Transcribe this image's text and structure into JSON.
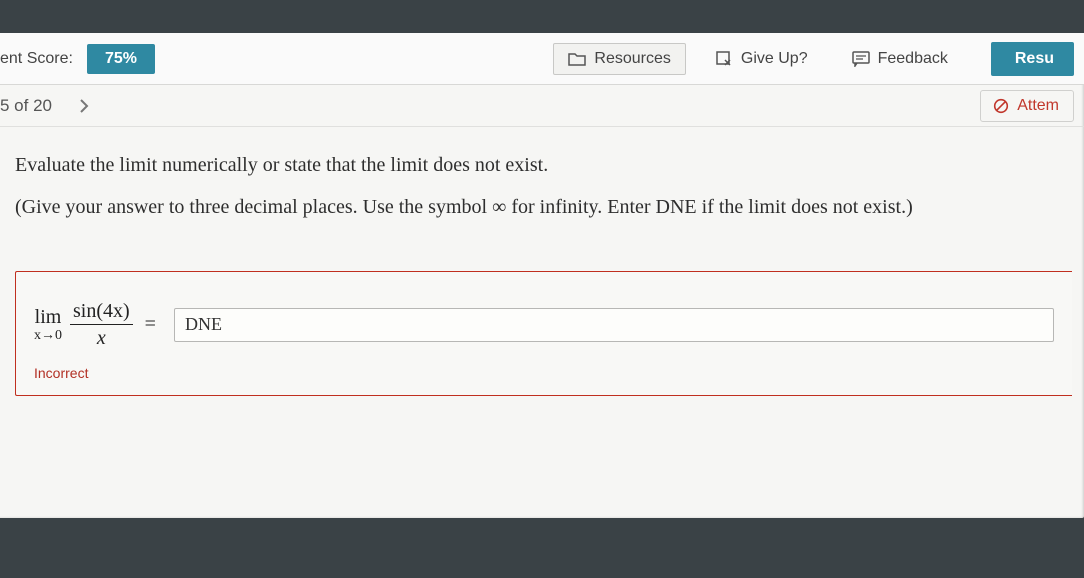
{
  "header": {
    "score_label": "ent Score:",
    "score_value": "75%",
    "resources_label": "Resources",
    "giveup_label": "Give Up?",
    "feedback_label": "Feedback",
    "result_label": "Resu"
  },
  "question_nav": {
    "position": "5 of 20",
    "attempt_label": "Attem"
  },
  "prompt": {
    "line1": "Evaluate the limit numerically or state that the limit does not exist.",
    "line2": "(Give your answer to three decimal places. Use the symbol ∞ for infinity. Enter DNE if the limit does not exist.)"
  },
  "equation": {
    "lim": "lim",
    "approach": "x→0",
    "numerator": "sin(4x)",
    "denominator": "x",
    "equals": "="
  },
  "answer": {
    "value": "DNE",
    "status": "Incorrect"
  }
}
